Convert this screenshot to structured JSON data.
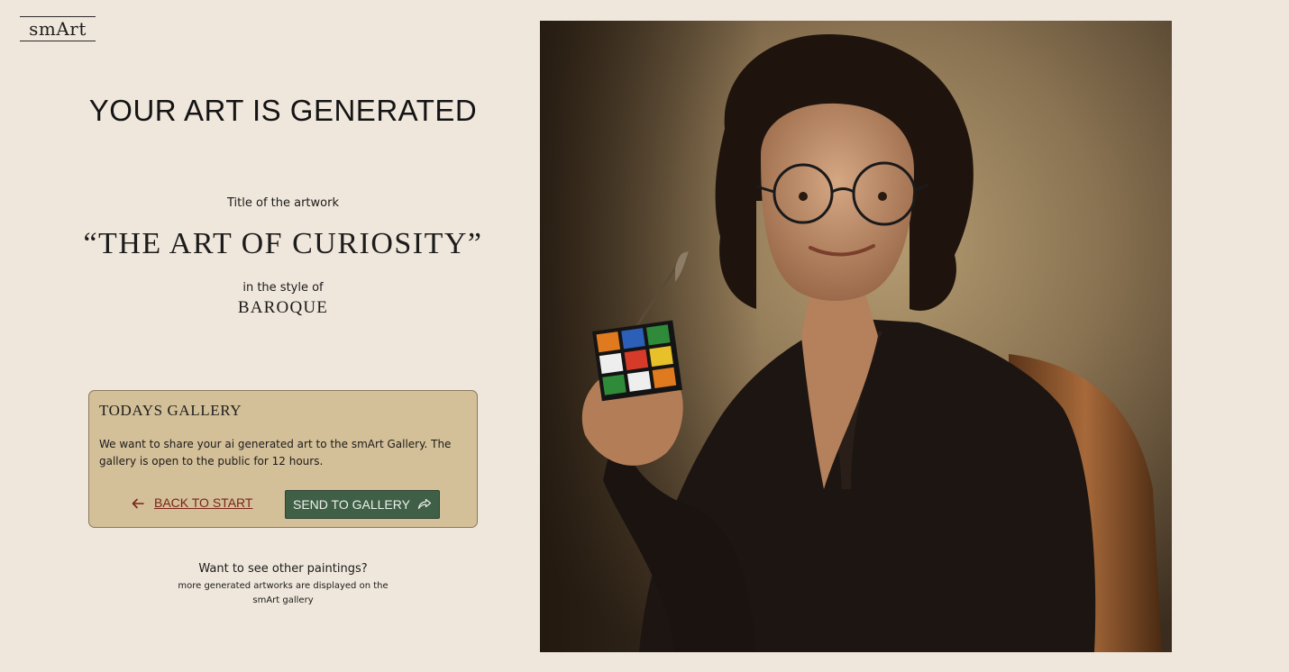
{
  "brand": {
    "logo": "smArt"
  },
  "result": {
    "headline": "YOUR ART IS GENERATED",
    "title_label": "Title of the artwork",
    "artwork_title": "“THE ART OF CURIOSITY”",
    "style_label": "in the style of",
    "style_value": "BAROQUE"
  },
  "gallery": {
    "heading": "TODAYS GALLERY",
    "description": "We want to share your ai generated art to the smArt Gallery. The gallery is open to the public for 12 hours.",
    "back_label": "BACK TO START",
    "send_label": "SEND TO GALLERY"
  },
  "footer": {
    "question": "Want to see other paintings?",
    "description": "more generated artworks are displayed on the smArt gallery"
  },
  "icons": {
    "back": "arrow-left-icon",
    "send": "share-arrow-icon"
  },
  "colors": {
    "page_bg": "#f0e7dc",
    "card_bg": "#d3bf98",
    "send_button_bg": "#3f5f47",
    "back_link": "#7a2418"
  }
}
